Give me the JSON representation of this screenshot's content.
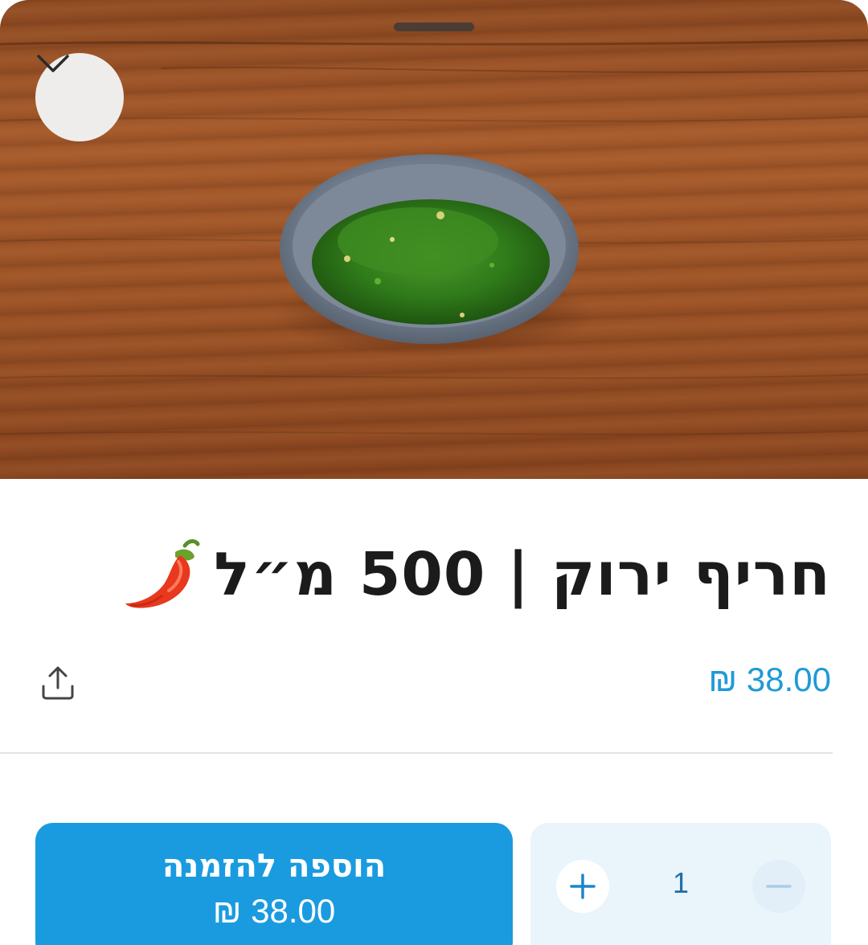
{
  "product": {
    "title": "חריף ירוק | 500 מ״ל",
    "price": "38.00 ₪",
    "image_icon": "green-chili-paste-bowl"
  },
  "actions": {
    "collapse_icon": "chevron-down-icon",
    "share_icon": "share-upload-icon",
    "add_to_order_label": "הוספה להזמנה",
    "add_to_order_amount": "38.00 ₪"
  },
  "quantity": {
    "value": "1",
    "plus_icon": "plus-icon",
    "minus_icon": "minus-icon"
  },
  "colors": {
    "accent": "#1a9be0",
    "price_text": "#1f9ad6",
    "stepper_bg": "#eaf4fb"
  }
}
